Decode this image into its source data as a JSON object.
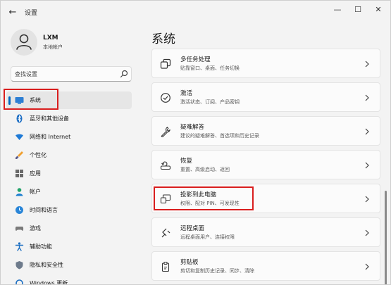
{
  "window": {
    "back_glyph": "←",
    "title": "设置",
    "minimize_glyph": "—",
    "maximize_glyph": "☐",
    "close_glyph": "✕"
  },
  "account": {
    "name": "LXM",
    "type": "本地帐户"
  },
  "search": {
    "placeholder": "查找设置"
  },
  "sidebar": {
    "items": [
      {
        "label": "系统",
        "icon": "monitor-icon",
        "active": true
      },
      {
        "label": "蓝牙和其他设备",
        "icon": "bluetooth-icon"
      },
      {
        "label": "网络和 Internet",
        "icon": "wifi-icon"
      },
      {
        "label": "个性化",
        "icon": "brush-icon"
      },
      {
        "label": "应用",
        "icon": "apps-icon"
      },
      {
        "label": "帐户",
        "icon": "person-icon"
      },
      {
        "label": "时间和语言",
        "icon": "globe-clock-icon"
      },
      {
        "label": "游戏",
        "icon": "game-icon"
      },
      {
        "label": "辅助功能",
        "icon": "accessibility-icon"
      },
      {
        "label": "隐私和安全性",
        "icon": "shield-icon"
      },
      {
        "label": "Windows 更新",
        "icon": "update-icon"
      }
    ]
  },
  "main": {
    "title": "系统",
    "cards": [
      {
        "title": "多任务处理",
        "subtitle": "贴靠窗口、桌面、任务切换",
        "icon": "multitask-icon"
      },
      {
        "title": "激活",
        "subtitle": "激活状态、订阅、产品密钥",
        "icon": "activation-icon"
      },
      {
        "title": "疑难解答",
        "subtitle": "建议的疑难解答、首选项和历史记录",
        "icon": "wrench-icon"
      },
      {
        "title": "恢复",
        "subtitle": "重置、高级启动、返回",
        "icon": "recovery-icon"
      },
      {
        "title": "投影到此电脑",
        "subtitle": "权限、配对 PIN、可发现性",
        "icon": "projection-icon"
      },
      {
        "title": "远程桌面",
        "subtitle": "远程桌面用户、连接权限",
        "icon": "remote-desktop-icon"
      },
      {
        "title": "剪贴板",
        "subtitle": "剪切和复制历史记录、同步、清除",
        "icon": "clipboard-icon"
      }
    ]
  },
  "colors": {
    "accent": "#0067c0",
    "highlight": "#d91e1e"
  }
}
